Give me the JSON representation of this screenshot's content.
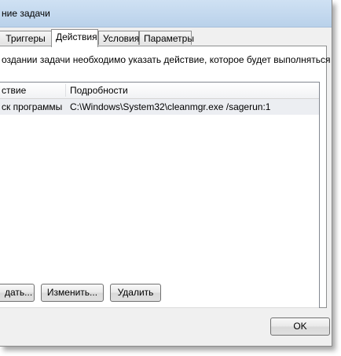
{
  "window": {
    "title": "ние задачи"
  },
  "tabs": [
    {
      "label": "Триггеры",
      "active": false
    },
    {
      "label": "Действия",
      "active": true
    },
    {
      "label": "Условия",
      "active": false
    },
    {
      "label": "Параметры",
      "active": false
    }
  ],
  "actions_tab": {
    "description": "оздании задачи необходимо указать действие, которое будет выполняться при ее за",
    "list": {
      "columns": [
        "ствие",
        "Подробности"
      ],
      "rows": [
        {
          "action": "ск программы",
          "details": "C:\\Windows\\System32\\cleanmgr.exe /sagerun:1"
        }
      ]
    },
    "buttons": {
      "create": "дать...",
      "edit": "Изменить...",
      "delete": "Удалить"
    }
  },
  "footer": {
    "ok": "OK"
  },
  "colors": {
    "titlebar": "#c4d9ef",
    "selected_row": "#eceef2"
  }
}
